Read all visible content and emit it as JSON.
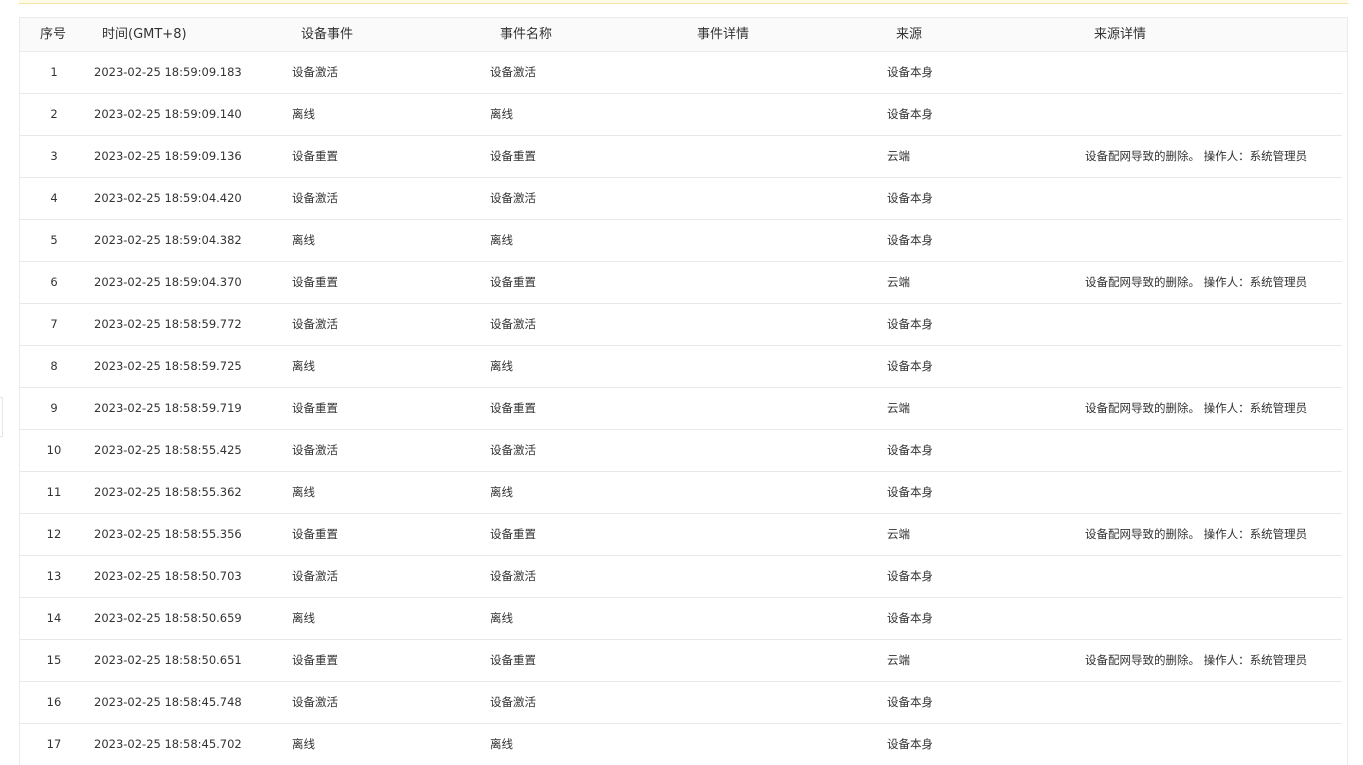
{
  "table": {
    "headers": {
      "index": "序号",
      "time": "时间(GMT+8)",
      "event": "设备事件",
      "event_name": "事件名称",
      "event_detail": "事件详情",
      "source": "来源",
      "source_detail": "来源详情"
    },
    "rows": [
      {
        "index": "1",
        "time": "2023-02-25 18:59:09.183",
        "event": "设备激活",
        "event_name": "设备激活",
        "event_detail": "",
        "source": "设备本身",
        "source_detail": ""
      },
      {
        "index": "2",
        "time": "2023-02-25 18:59:09.140",
        "event": "离线",
        "event_name": "离线",
        "event_detail": "",
        "source": "设备本身",
        "source_detail": ""
      },
      {
        "index": "3",
        "time": "2023-02-25 18:59:09.136",
        "event": "设备重置",
        "event_name": "设备重置",
        "event_detail": "",
        "source": "云端",
        "source_detail": "设备配网导致的删除。 操作人：系统管理员"
      },
      {
        "index": "4",
        "time": "2023-02-25 18:59:04.420",
        "event": "设备激活",
        "event_name": "设备激活",
        "event_detail": "",
        "source": "设备本身",
        "source_detail": ""
      },
      {
        "index": "5",
        "time": "2023-02-25 18:59:04.382",
        "event": "离线",
        "event_name": "离线",
        "event_detail": "",
        "source": "设备本身",
        "source_detail": ""
      },
      {
        "index": "6",
        "time": "2023-02-25 18:59:04.370",
        "event": "设备重置",
        "event_name": "设备重置",
        "event_detail": "",
        "source": "云端",
        "source_detail": "设备配网导致的删除。 操作人：系统管理员"
      },
      {
        "index": "7",
        "time": "2023-02-25 18:58:59.772",
        "event": "设备激活",
        "event_name": "设备激活",
        "event_detail": "",
        "source": "设备本身",
        "source_detail": ""
      },
      {
        "index": "8",
        "time": "2023-02-25 18:58:59.725",
        "event": "离线",
        "event_name": "离线",
        "event_detail": "",
        "source": "设备本身",
        "source_detail": ""
      },
      {
        "index": "9",
        "time": "2023-02-25 18:58:59.719",
        "event": "设备重置",
        "event_name": "设备重置",
        "event_detail": "",
        "source": "云端",
        "source_detail": "设备配网导致的删除。 操作人：系统管理员"
      },
      {
        "index": "10",
        "time": "2023-02-25 18:58:55.425",
        "event": "设备激活",
        "event_name": "设备激活",
        "event_detail": "",
        "source": "设备本身",
        "source_detail": ""
      },
      {
        "index": "11",
        "time": "2023-02-25 18:58:55.362",
        "event": "离线",
        "event_name": "离线",
        "event_detail": "",
        "source": "设备本身",
        "source_detail": ""
      },
      {
        "index": "12",
        "time": "2023-02-25 18:58:55.356",
        "event": "设备重置",
        "event_name": "设备重置",
        "event_detail": "",
        "source": "云端",
        "source_detail": "设备配网导致的删除。 操作人：系统管理员"
      },
      {
        "index": "13",
        "time": "2023-02-25 18:58:50.703",
        "event": "设备激活",
        "event_name": "设备激活",
        "event_detail": "",
        "source": "设备本身",
        "source_detail": ""
      },
      {
        "index": "14",
        "time": "2023-02-25 18:58:50.659",
        "event": "离线",
        "event_name": "离线",
        "event_detail": "",
        "source": "设备本身",
        "source_detail": ""
      },
      {
        "index": "15",
        "time": "2023-02-25 18:58:50.651",
        "event": "设备重置",
        "event_name": "设备重置",
        "event_detail": "",
        "source": "云端",
        "source_detail": "设备配网导致的删除。 操作人：系统管理员"
      },
      {
        "index": "16",
        "time": "2023-02-25 18:58:45.748",
        "event": "设备激活",
        "event_name": "设备激活",
        "event_detail": "",
        "source": "设备本身",
        "source_detail": ""
      },
      {
        "index": "17",
        "time": "2023-02-25 18:58:45.702",
        "event": "离线",
        "event_name": "离线",
        "event_detail": "",
        "source": "设备本身",
        "source_detail": ""
      }
    ]
  }
}
